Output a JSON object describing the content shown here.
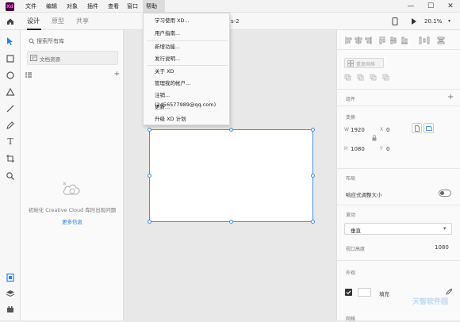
{
  "titlebar": {
    "logo_text": "Xd",
    "menus": [
      "文件",
      "编辑",
      "对象",
      "插件",
      "查看",
      "窗口",
      "帮助"
    ],
    "window_buttons": [
      "—",
      "☐",
      "✕"
    ]
  },
  "tabs": [
    "设计",
    "原型",
    "共享"
  ],
  "toolbar": {
    "doc_name_fragment": "s-2",
    "zoom": "20.1%"
  },
  "library": {
    "search_placeholder": "搜索所有库",
    "doc_assets": "文档资源",
    "empty_message": "初始化 Creative Cloud 库时出现问题",
    "more_info": "更多信息"
  },
  "help_menu": {
    "items": [
      "学习使用 XD...",
      "用户指南...",
      "新增功能...",
      "发行说明...",
      "关于 XD",
      "管理我的帐户...",
      "注销... (2456577989@qq.com)",
      "更新...",
      "升级 XD 计划"
    ]
  },
  "right_panel": {
    "repeat_grid": "重复网格",
    "component_label": "组件",
    "transform_label": "变换",
    "w_label": "W",
    "w_value": "1920",
    "x_label": "X",
    "x_value": "0",
    "h_label": "H",
    "h_value": "1080",
    "y_label": "Y",
    "y_value": "0",
    "layout_label": "布局",
    "responsive_label": "响应式调整大小",
    "scroll_label": "滚动",
    "scroll_value": "垂直",
    "viewport_label": "视口高度",
    "viewport_value": "1080",
    "appearance_label": "外观",
    "fill_label": "填充",
    "grid_label": "网格"
  },
  "watermark": "天智软件园"
}
